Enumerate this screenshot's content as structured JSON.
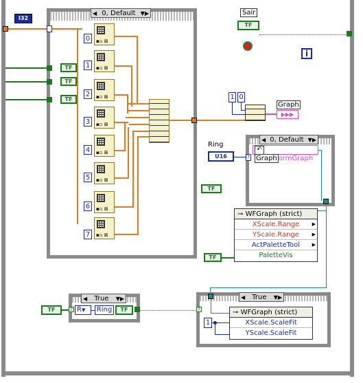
{
  "main_case": {
    "selector": "0, Default",
    "cases": [
      "0",
      "1",
      "2",
      "3",
      "4",
      "5",
      "6",
      "7"
    ]
  },
  "input_const": "I32",
  "stop": {
    "label": "Sair",
    "bool": "TF"
  },
  "info_icon": "i",
  "bundle_consts": [
    "1",
    "0"
  ],
  "graph_label": "Graph",
  "ring": {
    "label": "Ring",
    "type": "U16"
  },
  "inner_case": {
    "selector": "0, Default",
    "graph_ref": "Graph",
    "ref_text": "ormGraph"
  },
  "bool_tf": "TF",
  "prop_top": {
    "header": "WFGraph (strict)",
    "rows": [
      "XScale.Range",
      "YScale.Range",
      "ActPaletteTool",
      "PaletteVis"
    ],
    "colors": [
      "#c43a2a",
      "#c43a2a",
      "#1a2aa0",
      "#1c7a1c"
    ]
  },
  "bottom_left_case": {
    "selector": "True",
    "ring_short": "R",
    "ring_label": "Ring",
    "bool": "TF"
  },
  "bottom_right_case": {
    "selector": "True",
    "const": "1",
    "header": "WFGraph (strict)",
    "rows": [
      "XScale.ScaleFit",
      "YScale.ScaleFit"
    ],
    "colors": [
      "#1a2aa0",
      "#1a2aa0"
    ]
  }
}
